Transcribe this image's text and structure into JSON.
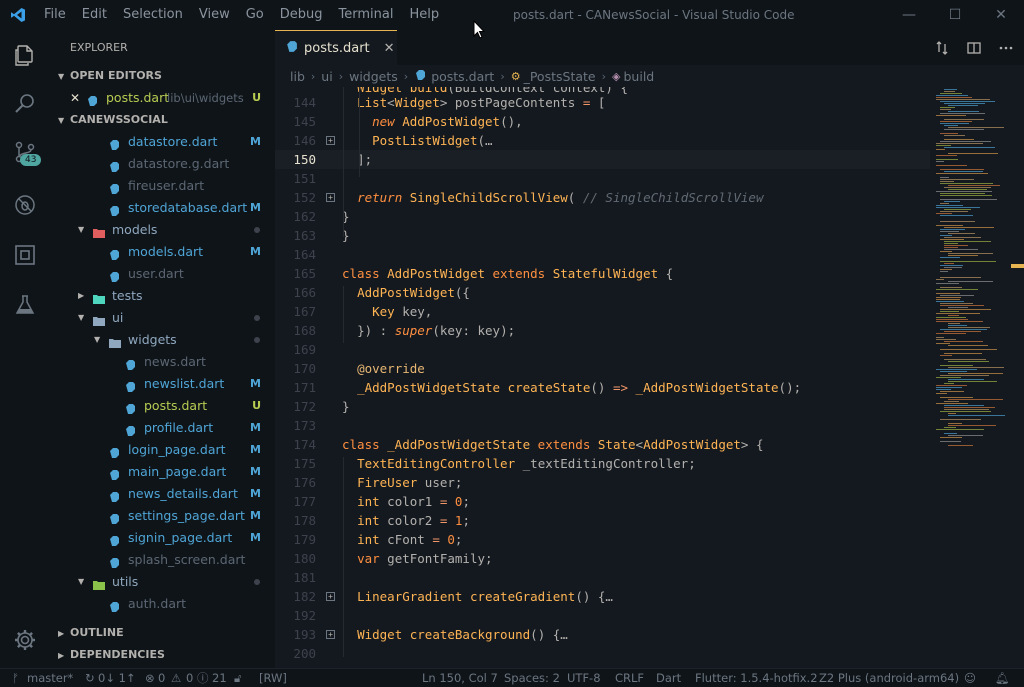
{
  "titlebar": {
    "menu": [
      "File",
      "Edit",
      "Selection",
      "View",
      "Go",
      "Debug",
      "Terminal",
      "Help"
    ],
    "window_title": "posts.dart - CANewsSocial - Visual Studio Code",
    "controls": [
      "—",
      "☐",
      "✕"
    ]
  },
  "activity": {
    "scm_badge": "43"
  },
  "sidebar": {
    "header": "EXPLORER",
    "open_editors_label": "OPEN EDITORS",
    "open_editor": {
      "close": "✕",
      "name": "posts.dart",
      "path": "lib\\ui\\widgets",
      "status": "U"
    },
    "project_label": "CANEWSSOCIAL",
    "outline_label": "OUTLINE",
    "dependencies_label": "DEPENDENCIES",
    "tree": [
      {
        "name": "datastore.dart",
        "status": "M",
        "kind": "file",
        "indent": 1
      },
      {
        "name": "datastore.g.dart",
        "status": "",
        "kind": "file-dim",
        "indent": 1
      },
      {
        "name": "fireuser.dart",
        "status": "",
        "kind": "file-dim",
        "indent": 1
      },
      {
        "name": "storedatabase.dart",
        "status": "M",
        "kind": "file",
        "indent": 1
      },
      {
        "name": "models",
        "status": "dot",
        "kind": "folder-open-red",
        "indent": 0
      },
      {
        "name": "models.dart",
        "status": "M",
        "kind": "file",
        "indent": 1
      },
      {
        "name": "user.dart",
        "status": "",
        "kind": "file-dim",
        "indent": 1
      },
      {
        "name": "tests",
        "status": "",
        "kind": "folder-closed-teal",
        "indent": 0
      },
      {
        "name": "ui",
        "status": "dot",
        "kind": "folder-open",
        "indent": 0
      },
      {
        "name": "widgets",
        "status": "dot",
        "kind": "folder-open",
        "indent": 1
      },
      {
        "name": "news.dart",
        "status": "",
        "kind": "file-dim",
        "indent": 2
      },
      {
        "name": "newslist.dart",
        "status": "M",
        "kind": "file",
        "indent": 2
      },
      {
        "name": "posts.dart",
        "status": "U",
        "kind": "file-active",
        "indent": 2
      },
      {
        "name": "profile.dart",
        "status": "M",
        "kind": "file",
        "indent": 2
      },
      {
        "name": "login_page.dart",
        "status": "M",
        "kind": "file",
        "indent": 1
      },
      {
        "name": "main_page.dart",
        "status": "M",
        "kind": "file",
        "indent": 1
      },
      {
        "name": "news_details.dart",
        "status": "M",
        "kind": "file",
        "indent": 1
      },
      {
        "name": "settings_page.dart",
        "status": "M",
        "kind": "file",
        "indent": 1
      },
      {
        "name": "signin_page.dart",
        "status": "M",
        "kind": "file",
        "indent": 1
      },
      {
        "name": "splash_screen.dart",
        "status": "",
        "kind": "file-dim",
        "indent": 1
      },
      {
        "name": "utils",
        "status": "dot",
        "kind": "folder-open-green",
        "indent": 0
      },
      {
        "name": "auth.dart",
        "status": "",
        "kind": "file-dim",
        "indent": 1
      }
    ]
  },
  "tab": {
    "name": "posts.dart",
    "close": "✕"
  },
  "breadcrumbs": [
    "lib",
    "ui",
    "widgets",
    "posts.dart",
    "_PostsState",
    "build"
  ],
  "editor": {
    "lines": [
      {
        "n": "144",
        "fold": false,
        "curline": false
      },
      {
        "n": "145",
        "fold": false,
        "curline": false
      },
      {
        "n": "146",
        "fold": true,
        "curline": false
      },
      {
        "n": "150",
        "fold": false,
        "curline": true
      },
      {
        "n": "151",
        "fold": false,
        "curline": false
      },
      {
        "n": "152",
        "fold": true,
        "curline": false
      },
      {
        "n": "162",
        "fold": false,
        "curline": false
      },
      {
        "n": "163",
        "fold": false,
        "curline": false
      },
      {
        "n": "164",
        "fold": false,
        "curline": false
      },
      {
        "n": "165",
        "fold": false,
        "curline": false
      },
      {
        "n": "166",
        "fold": false,
        "curline": false
      },
      {
        "n": "167",
        "fold": false,
        "curline": false
      },
      {
        "n": "168",
        "fold": false,
        "curline": false
      },
      {
        "n": "169",
        "fold": false,
        "curline": false
      },
      {
        "n": "170",
        "fold": false,
        "curline": false
      },
      {
        "n": "171",
        "fold": false,
        "curline": false
      },
      {
        "n": "172",
        "fold": false,
        "curline": false
      },
      {
        "n": "173",
        "fold": false,
        "curline": false
      },
      {
        "n": "174",
        "fold": false,
        "curline": false
      },
      {
        "n": "175",
        "fold": false,
        "curline": false
      },
      {
        "n": "176",
        "fold": false,
        "curline": false
      },
      {
        "n": "177",
        "fold": false,
        "curline": false
      },
      {
        "n": "178",
        "fold": false,
        "curline": false
      },
      {
        "n": "179",
        "fold": false,
        "curline": false
      },
      {
        "n": "180",
        "fold": false,
        "curline": false
      },
      {
        "n": "181",
        "fold": false,
        "curline": false
      },
      {
        "n": "182",
        "fold": true,
        "curline": false
      },
      {
        "n": "192",
        "fold": false,
        "curline": false
      },
      {
        "n": "193",
        "fold": true,
        "curline": false
      },
      {
        "n": "200",
        "fold": false,
        "curline": false
      }
    ],
    "code": {
      "l144": [
        [
          "  ",
          ""
        ],
        [
          "List",
          "ty"
        ],
        [
          "<",
          "pu"
        ],
        [
          "Widget",
          "ty"
        ],
        [
          "> postPageContents ",
          "pu"
        ],
        [
          "=",
          "op"
        ],
        [
          " [",
          "pu"
        ]
      ],
      "l145": [
        [
          "    ",
          ""
        ],
        [
          "new ",
          "it"
        ],
        [
          "AddPostWidget",
          "fn"
        ],
        [
          "(),",
          "pu"
        ]
      ],
      "l146": [
        [
          "    ",
          ""
        ],
        [
          "PostListWidget",
          "fn"
        ],
        [
          "(",
          "pu"
        ],
        [
          "…",
          "pu"
        ]
      ],
      "l150": [
        [
          "  ",
          ""
        ],
        [
          "];",
          "pu"
        ]
      ],
      "l151": [],
      "l152": [
        [
          "  ",
          ""
        ],
        [
          "return ",
          "it"
        ],
        [
          "SingleChildScrollView",
          "fn"
        ],
        [
          "( ",
          "pu"
        ],
        [
          "// SingleChildScrollView",
          "cm"
        ]
      ],
      "l162": [
        [
          "}",
          "pu"
        ]
      ],
      "l163": [
        [
          "}",
          "pu"
        ]
      ],
      "l164": [],
      "l165": [
        [
          "class ",
          "kw"
        ],
        [
          "AddPostWidget ",
          "ty"
        ],
        [
          "extends ",
          "kw"
        ],
        [
          "StatefulWidget ",
          "ty"
        ],
        [
          "{",
          "pu"
        ]
      ],
      "l166": [
        [
          "  ",
          ""
        ],
        [
          "AddPostWidget",
          "fn"
        ],
        [
          "({",
          "pu"
        ]
      ],
      "l167": [
        [
          "    ",
          ""
        ],
        [
          "Key ",
          "ty"
        ],
        [
          "key,",
          "pu"
        ]
      ],
      "l168": [
        [
          "  ",
          ""
        ],
        [
          "}) : ",
          "pu"
        ],
        [
          "super",
          "it"
        ],
        [
          "(key: key);",
          "pu"
        ]
      ],
      "l169": [],
      "l170": [
        [
          "  ",
          ""
        ],
        [
          "@override",
          "an"
        ]
      ],
      "l171": [
        [
          "  ",
          ""
        ],
        [
          "_AddPostWidgetState ",
          "ty"
        ],
        [
          "createState",
          "fn"
        ],
        [
          "() ",
          "pu"
        ],
        [
          "=>",
          "op"
        ],
        [
          " ",
          "pu"
        ],
        [
          "_AddPostWidgetState",
          "fn"
        ],
        [
          "();",
          "pu"
        ]
      ],
      "l172": [
        [
          "}",
          "pu"
        ]
      ],
      "l173": [],
      "l174": [
        [
          "class ",
          "kw"
        ],
        [
          "_AddPostWidgetState ",
          "ty"
        ],
        [
          "extends ",
          "kw"
        ],
        [
          "State",
          "ty"
        ],
        [
          "<",
          "pu"
        ],
        [
          "AddPostWidget",
          "ty"
        ],
        [
          "> {",
          "pu"
        ]
      ],
      "l175": [
        [
          "  ",
          ""
        ],
        [
          "TextEditingController ",
          "ty"
        ],
        [
          "_textEditingController;",
          "pu"
        ]
      ],
      "l176": [
        [
          "  ",
          ""
        ],
        [
          "FireUser ",
          "ty"
        ],
        [
          "user;",
          "pu"
        ]
      ],
      "l177": [
        [
          "  ",
          ""
        ],
        [
          "int ",
          "ty"
        ],
        [
          "color1 ",
          "pu"
        ],
        [
          "= ",
          "op"
        ],
        [
          "0",
          "num2"
        ],
        [
          ";",
          "pu"
        ]
      ],
      "l178": [
        [
          "  ",
          ""
        ],
        [
          "int ",
          "ty"
        ],
        [
          "color2 ",
          "pu"
        ],
        [
          "= ",
          "op"
        ],
        [
          "1",
          "num2"
        ],
        [
          ";",
          "pu"
        ]
      ],
      "l179": [
        [
          "  ",
          ""
        ],
        [
          "int ",
          "ty"
        ],
        [
          "cFont ",
          "pu"
        ],
        [
          "= ",
          "op"
        ],
        [
          "0",
          "num2"
        ],
        [
          ";",
          "pu"
        ]
      ],
      "l180": [
        [
          "  ",
          ""
        ],
        [
          "var ",
          "kw"
        ],
        [
          "getFontFamily;",
          "pu"
        ]
      ],
      "l181": [],
      "l182": [
        [
          "  ",
          ""
        ],
        [
          "LinearGradient ",
          "ty"
        ],
        [
          "createGradient",
          "fn"
        ],
        [
          "() {",
          "pu"
        ],
        [
          "…",
          "pu"
        ]
      ],
      "l192": [],
      "l193": [
        [
          "  ",
          ""
        ],
        [
          "Widget ",
          "ty"
        ],
        [
          "createBackground",
          "fn"
        ],
        [
          "() {",
          "pu"
        ],
        [
          "…",
          "pu"
        ]
      ],
      "l200": []
    }
  },
  "statusbar": {
    "branch": "master*",
    "sync": "0↓ 1↑",
    "errors": "0",
    "warnings": "0",
    "infos": "21",
    "rw": "[RW]",
    "position": "Ln 150, Col 7",
    "spaces": "Spaces: 2",
    "encoding": "UTF-8",
    "eol": "CRLF",
    "language": "Dart",
    "flutter": "Flutter: 1.5.4-hotfix.2",
    "device": "Z2 Plus (android-arm64)"
  },
  "colors": {
    "accent": "#e6b450",
    "modified": "#4fa5d6",
    "untracked": "#b8cc52",
    "background": "#0f1419",
    "editor_bg": "#14191f"
  }
}
